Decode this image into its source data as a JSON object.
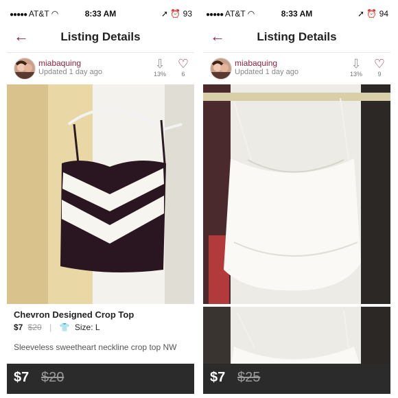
{
  "left": {
    "status": {
      "carrier": "AT&T",
      "time": "8:33 AM",
      "battery": "93"
    },
    "nav": {
      "title": "Listing Details"
    },
    "seller": {
      "username": "miabaquing",
      "updated": "Updated 1 day ago",
      "shares_pct": "13%",
      "likes": "6"
    },
    "listing": {
      "title": "Chevron Designed Crop Top",
      "price": "$7",
      "original_price": "$20",
      "size": "Size: L",
      "description": "Sleeveless sweetheart neckline crop top NW"
    },
    "bottom": {
      "price": "$7",
      "original_price": "$20"
    }
  },
  "right": {
    "status": {
      "carrier": "AT&T",
      "time": "8:33 AM",
      "battery": "94"
    },
    "nav": {
      "title": "Listing Details"
    },
    "seller": {
      "username": "miabaquing",
      "updated": "Updated 1 day ago",
      "shares_pct": "13%",
      "likes": "9"
    },
    "bottom": {
      "price": "$7",
      "original_price": "$25"
    }
  },
  "icons": {
    "back": "back-arrow-icon",
    "share": "share-arrow-down-icon",
    "like": "heart-icon",
    "size": "shirt-icon",
    "signal": "signal-dots-icon",
    "wifi": "wifi-icon",
    "location": "location-arrow-icon",
    "alarm": "alarm-clock-icon"
  },
  "colors": {
    "accent": "#8a2340",
    "bottom_bar": "#2b2b2b"
  }
}
